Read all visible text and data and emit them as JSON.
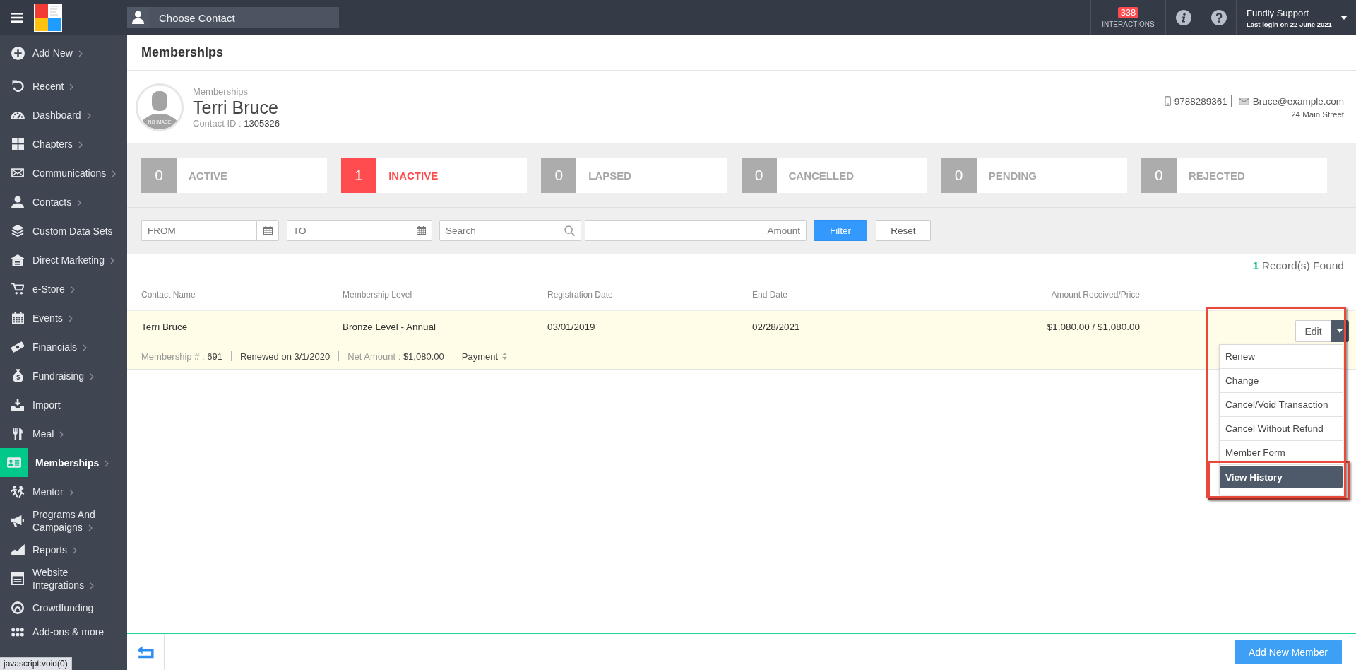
{
  "header": {
    "contact_picker": {
      "label": "Choose Contact"
    },
    "interactions": {
      "count": "338",
      "label": "INTERACTIONS"
    },
    "user": {
      "name": "Fundly Support",
      "last_login": "Last login on 22 June 2021"
    }
  },
  "sidebar": {
    "items": [
      {
        "label": "Add New",
        "has_submenu": true,
        "selected": false
      },
      {
        "label": "Recent",
        "has_submenu": true,
        "selected": false
      },
      {
        "label": "Dashboard",
        "has_submenu": true,
        "selected": false
      },
      {
        "label": "Chapters",
        "has_submenu": true,
        "selected": false
      },
      {
        "label": "Communications",
        "has_submenu": true,
        "selected": false
      },
      {
        "label": "Contacts",
        "has_submenu": true,
        "selected": false
      },
      {
        "label": "Custom Data Sets",
        "has_submenu": false,
        "selected": false
      },
      {
        "label": "Direct Marketing",
        "has_submenu": true,
        "selected": false
      },
      {
        "label": "e-Store",
        "has_submenu": true,
        "selected": false
      },
      {
        "label": "Events",
        "has_submenu": true,
        "selected": false
      },
      {
        "label": "Financials",
        "has_submenu": true,
        "selected": false
      },
      {
        "label": "Fundraising",
        "has_submenu": true,
        "selected": false
      },
      {
        "label": "Import",
        "has_submenu": false,
        "selected": false
      },
      {
        "label": "Meal",
        "has_submenu": true,
        "selected": false
      },
      {
        "label": "Memberships",
        "has_submenu": true,
        "selected": true
      },
      {
        "label": "Mentor",
        "has_submenu": true,
        "selected": false
      },
      {
        "label": "Programs And Campaigns",
        "has_submenu": true,
        "selected": false
      },
      {
        "label": "Reports",
        "has_submenu": true,
        "selected": false
      },
      {
        "label": "Website Integrations",
        "has_submenu": true,
        "selected": false
      },
      {
        "label": "Crowdfunding",
        "has_submenu": false,
        "selected": false
      }
    ],
    "bottom_item": {
      "label": "Add-ons & more",
      "selected": false
    }
  },
  "page": {
    "title": "Memberships"
  },
  "profile": {
    "avatar_caption": "NO IMAGE",
    "section": "Memberships",
    "name": "Terri Bruce",
    "contact_id_label": "Contact ID :",
    "contact_id": "1305326",
    "phone": "9788289361",
    "email": "Bruce@example.com",
    "address": "24 Main Street"
  },
  "status_cards": [
    {
      "count": "0",
      "label": "ACTIVE",
      "selected": false
    },
    {
      "count": "1",
      "label": "INACTIVE",
      "selected": true
    },
    {
      "count": "0",
      "label": "LAPSED",
      "selected": false
    },
    {
      "count": "0",
      "label": "CANCELLED",
      "selected": false
    },
    {
      "count": "0",
      "label": "PENDING",
      "selected": false
    },
    {
      "count": "0",
      "label": "REJECTED",
      "selected": false
    }
  ],
  "filters": {
    "from": {
      "placeholder": "FROM"
    },
    "to": {
      "placeholder": "TO"
    },
    "search": {
      "placeholder": "Search"
    },
    "amount": {
      "placeholder": "Amount"
    },
    "buttons": [
      {
        "label": "Filter",
        "kind": "primary"
      },
      {
        "label": "Reset",
        "kind": "default"
      }
    ]
  },
  "records": {
    "count": "1",
    "label": "Record(s) Found"
  },
  "table": {
    "columns": [
      "Contact Name",
      "Membership Level",
      "Registration Date",
      "End Date",
      "Amount Received/Price"
    ],
    "rows": [
      {
        "cells": [
          "Terri Bruce",
          "Bronze Level - Annual",
          "03/01/2019",
          "02/28/2021",
          "$1,080.00 / $1,080.00"
        ],
        "details": [
          {
            "kind": "field",
            "label": "Membership # :",
            "value": "691"
          },
          {
            "kind": "text",
            "text": "Renewed on 3/1/2020"
          },
          {
            "kind": "field",
            "label": "Net Amount :",
            "value": "$1,080.00"
          },
          {
            "kind": "sort",
            "text": "Payment"
          }
        ],
        "actions": {
          "edit_label": "Edit",
          "menu_open": true,
          "highlighted": true,
          "menu": [
            {
              "label": "Renew",
              "selected": false,
              "highlighted": false
            },
            {
              "label": "Change",
              "selected": false,
              "highlighted": false
            },
            {
              "label": "Cancel/Void Transaction",
              "selected": false,
              "highlighted": false
            },
            {
              "label": "Cancel Without Refund",
              "selected": false,
              "highlighted": false
            },
            {
              "label": "Member Form",
              "selected": false,
              "highlighted": false
            },
            {
              "label": "View History",
              "selected": true,
              "highlighted": true
            }
          ]
        }
      }
    ]
  },
  "footer": {
    "add_button": "Add New Member"
  },
  "browser_status": {
    "url": "javascript:void(0)"
  }
}
